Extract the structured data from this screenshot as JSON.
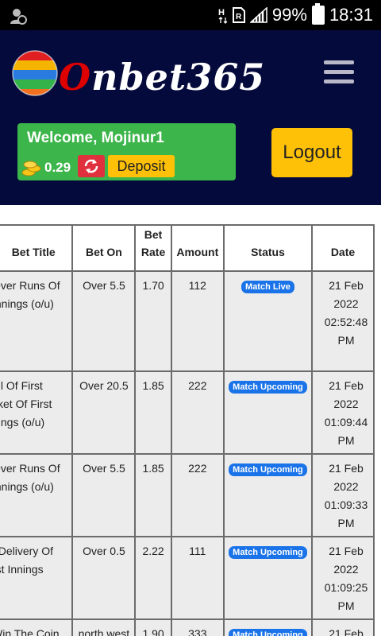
{
  "status_bar": {
    "battery": "99%",
    "time": "18:31",
    "icons": [
      "account-sync-icon",
      "network-h-icon",
      "sim-icon",
      "signal-icon",
      "battery-icon"
    ]
  },
  "header": {
    "logo_text": "Onbet365",
    "welcome_text": "Welcome, Mojinur1",
    "balance": "0.29",
    "deposit_label": "Deposit",
    "logout_label": "Logout",
    "colors": {
      "header_bg": "#050a3c",
      "welcome_bg": "#3cb54a",
      "accent": "#ffc107",
      "refresh": "#e0303e",
      "badge": "#1a73e8"
    }
  },
  "table": {
    "headers": [
      "Bet Title",
      "Bet On",
      "Bet Rate",
      "Amount",
      "Status",
      "Date"
    ],
    "rows": [
      {
        "title": "Over Runs Of Innings (o/u)",
        "title_lines": [
          "Over Runs Of",
          "Innings (o/u)"
        ],
        "bet_on": "Over 5.5",
        "rate": "1.70",
        "amount": "112",
        "status": "Match Live",
        "date": "21 Feb 2022 02:52:48 PM",
        "date_lines": [
          "21 Feb",
          "2022",
          "02:52:48",
          "PM"
        ]
      },
      {
        "title": "all Of First cket Of First nings (o/u)",
        "title_lines": [
          "all Of First",
          "cket Of First",
          "nings (o/u)"
        ],
        "bet_on": "Over 20.5",
        "rate": "1.85",
        "amount": "222",
        "status": "Match Upcoming",
        "date": "21 Feb 2022 01:09:44 PM",
        "date_lines": [
          "21 Feb",
          "2022",
          "01:09:44",
          "PM"
        ]
      },
      {
        "title": "Over Runs Of Innings (o/u)",
        "title_lines": [
          "Over Runs Of",
          "Innings (o/u)"
        ],
        "bet_on": "Over 5.5",
        "rate": "1.85",
        "amount": "222",
        "status": "Match Upcoming",
        "date": "21 Feb 2022 01:09:33 PM",
        "date_lines": [
          "21 Feb",
          "2022",
          "01:09:33",
          "PM"
        ]
      },
      {
        "title": "t Delivery Of rst Innings",
        "title_lines": [
          "t Delivery Of",
          "rst Innings"
        ],
        "bet_on": "Over 0.5",
        "rate": "2.22",
        "amount": "111",
        "status": "Match Upcoming",
        "date": "21 Feb 2022 01:09:25 PM",
        "date_lines": [
          "21 Feb",
          "2022",
          "01:09:25",
          "PM"
        ]
      },
      {
        "title": "Win The Coin",
        "title_lines": [
          "Win The Coin"
        ],
        "bet_on": "north west",
        "rate": "1.90",
        "amount": "333",
        "status": "Match Upcoming",
        "date": "21 Feb",
        "date_lines": [
          "21 Feb"
        ]
      }
    ]
  }
}
